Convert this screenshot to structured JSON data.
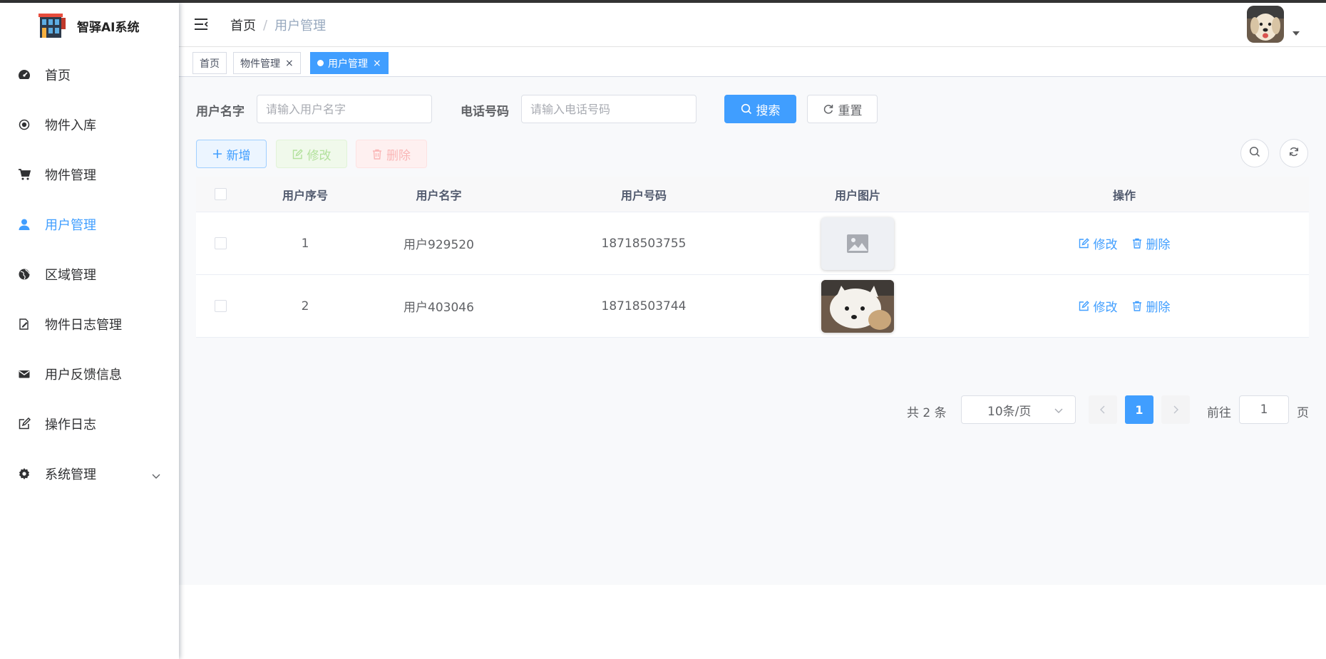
{
  "app": {
    "title": "智驿AI系统"
  },
  "sidebar": {
    "items": [
      {
        "label": "首页",
        "icon": "dashboard-icon"
      },
      {
        "label": "物件入库",
        "icon": "radio-icon"
      },
      {
        "label": "物件管理",
        "icon": "cart-icon"
      },
      {
        "label": "用户管理",
        "icon": "user-icon",
        "active": true
      },
      {
        "label": "区域管理",
        "icon": "globe-icon"
      },
      {
        "label": "物件日志管理",
        "icon": "log-edit-icon"
      },
      {
        "label": "用户反馈信息",
        "icon": "mail-icon"
      },
      {
        "label": "操作日志",
        "icon": "edit-icon"
      },
      {
        "label": "系统管理",
        "icon": "gear-icon"
      }
    ]
  },
  "header": {
    "breadcrumb": {
      "home": "首页",
      "sep": "/",
      "current": "用户管理"
    }
  },
  "tags": [
    {
      "label": "首页"
    },
    {
      "label": "物件管理",
      "close": "×"
    },
    {
      "label": "用户管理",
      "close": "×",
      "active": true
    }
  ],
  "search": {
    "name_label": "用户名字",
    "name_placeholder": "请输入用户名字",
    "phone_label": "电话号码",
    "phone_placeholder": "请输入电话号码",
    "search_btn": "搜索",
    "reset_btn": "重置"
  },
  "toolbar": {
    "add": "新增",
    "edit": "修改",
    "delete": "删除"
  },
  "table": {
    "columns": [
      "用户序号",
      "用户名字",
      "用户号码",
      "用户图片",
      "操作"
    ],
    "rows": [
      {
        "seq": "1",
        "name": "用户929520",
        "phone": "18718503755",
        "image": "placeholder",
        "edit": "修改",
        "delete": "删除"
      },
      {
        "seq": "2",
        "name": "用户403046",
        "phone": "18718503744",
        "image": "dog-photo",
        "edit": "修改",
        "delete": "删除"
      }
    ]
  },
  "pagination": {
    "total": "共 2 条",
    "page_size": "10条/页",
    "current_page": "1",
    "goto_prefix": "前往",
    "goto_value": "1",
    "goto_suffix": "页"
  },
  "colors": {
    "primary": "#409eff",
    "sidebar_active": "#409eff"
  }
}
